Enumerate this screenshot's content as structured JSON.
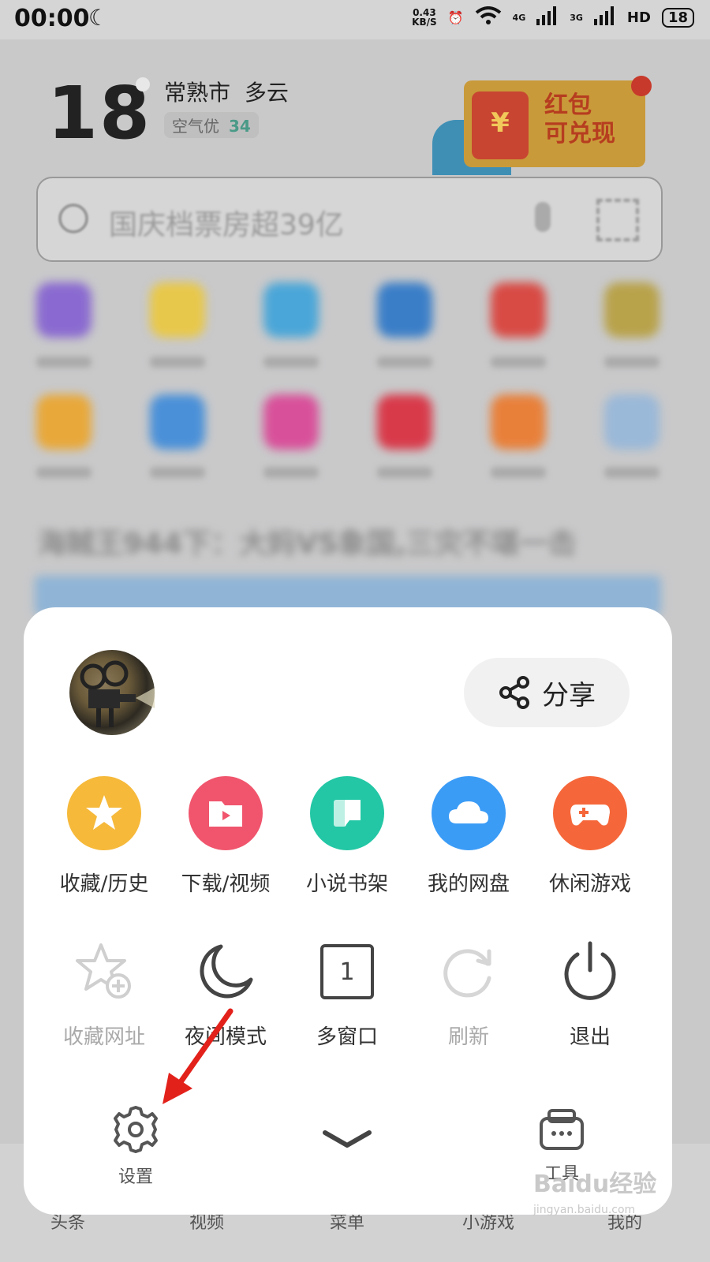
{
  "status_bar": {
    "time": "00:00",
    "net_speed_value": "0.43",
    "net_speed_unit": "KB/S",
    "network_4g": "4G",
    "network_3g": "3G",
    "hd": "HD",
    "battery": "18"
  },
  "weather": {
    "temperature": "18",
    "city": "常熟市",
    "condition": "多云",
    "air_quality_label": "空气优",
    "air_quality_value": "34"
  },
  "promo": {
    "line1": "红包",
    "line2": "可兑现"
  },
  "search": {
    "placeholder": "国庆档票房超39亿"
  },
  "headline": "海贼王944下：大妈VS象国,三灾不堪一击",
  "menu": {
    "share_label": "分享",
    "features": [
      {
        "label": "收藏/历史",
        "color": "#f6b93a"
      },
      {
        "label": "下载/视频",
        "color": "#f0556d"
      },
      {
        "label": "小说书架",
        "color": "#23c7a5"
      },
      {
        "label": "我的网盘",
        "color": "#3b9cf6"
      },
      {
        "label": "休闲游戏",
        "color": "#f5673a"
      }
    ],
    "actions": [
      {
        "label": "收藏网址",
        "enabled": false
      },
      {
        "label": "夜间模式",
        "enabled": true
      },
      {
        "label": "多窗口",
        "enabled": true,
        "count": "1"
      },
      {
        "label": "刷新",
        "enabled": false
      },
      {
        "label": "退出",
        "enabled": true
      }
    ],
    "settings_label": "设置",
    "tools_label": "工具"
  },
  "bottom_nav": [
    "头条",
    "视频",
    "菜单",
    "小游戏",
    "我的"
  ],
  "watermark": {
    "brand": "Baidu经验",
    "url": "jingyan.baidu.com"
  }
}
